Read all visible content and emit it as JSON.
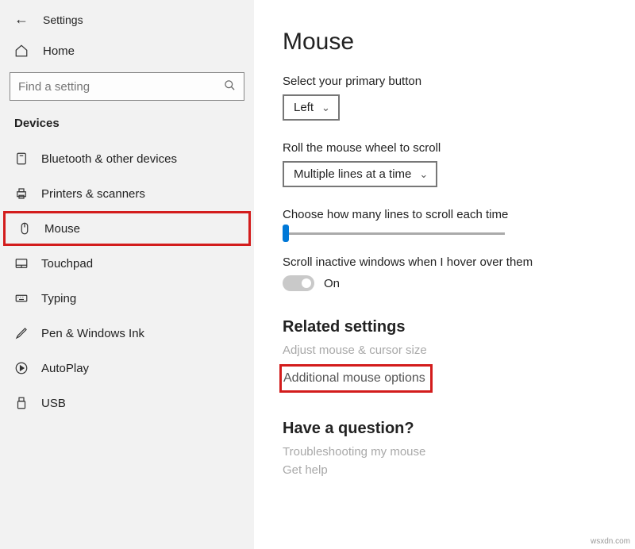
{
  "header": {
    "title": "Settings"
  },
  "home": {
    "label": "Home"
  },
  "search": {
    "placeholder": "Find a setting"
  },
  "category": "Devices",
  "nav": [
    {
      "label": "Bluetooth & other devices"
    },
    {
      "label": "Printers & scanners"
    },
    {
      "label": "Mouse"
    },
    {
      "label": "Touchpad"
    },
    {
      "label": "Typing"
    },
    {
      "label": "Pen & Windows Ink"
    },
    {
      "label": "AutoPlay"
    },
    {
      "label": "USB"
    }
  ],
  "page": {
    "title": "Mouse",
    "primary": {
      "label": "Select your primary button",
      "value": "Left"
    },
    "scroll": {
      "label": "Roll the mouse wheel to scroll",
      "value": "Multiple lines at a time"
    },
    "lines": {
      "label": "Choose how many lines to scroll each time"
    },
    "inactive": {
      "label": "Scroll inactive windows when I hover over them",
      "value": "On"
    },
    "related": {
      "title": "Related settings",
      "adjust": "Adjust mouse & cursor size",
      "additional": "Additional mouse options"
    },
    "question": {
      "title": "Have a question?",
      "troubleshoot": "Troubleshooting my mouse",
      "help": "Get help"
    }
  },
  "watermark": "wsxdn.com"
}
